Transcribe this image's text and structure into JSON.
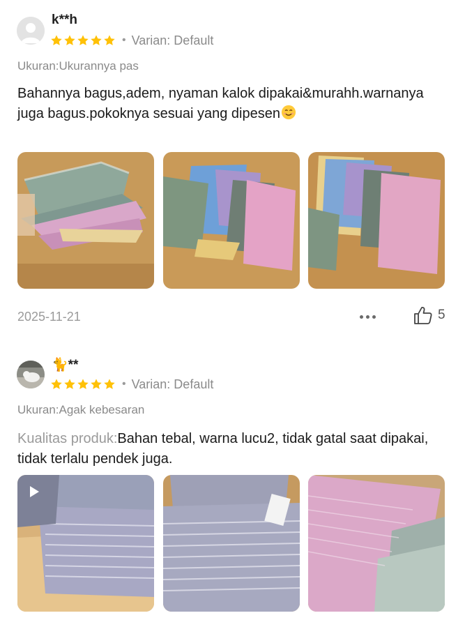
{
  "reviews": [
    {
      "username": "k**h",
      "rating": 5,
      "variant": "Varian: Default",
      "size_fit": "Ukuran:Ukurannya pas",
      "text": "Bahannya bagus,adem, nyaman kalok dipakai&murahh.warnanya juga bagus.pokoknya sesuai yang dipesen",
      "emoji_icon": "smiling-face-icon",
      "photos": [
        "photo-1",
        "photo-2",
        "photo-3"
      ],
      "date": "2025-11-21",
      "like_count": "5"
    },
    {
      "username": "🐈**",
      "rating": 5,
      "variant": "Varian: Default",
      "size_fit": "Ukuran:Agak kebesaran",
      "quality_label": "Kualitas produk:",
      "text": "Bahan tebal, warna lucu2, tidak gatal saat dipakai, tidak terlalu pendek juga.",
      "photos": [
        "video-1",
        "photo-2",
        "photo-3"
      ]
    }
  ],
  "colors": {
    "star": "#FFC107",
    "muted_text": "#8a8a8a",
    "body_text": "#1a1a1a"
  }
}
